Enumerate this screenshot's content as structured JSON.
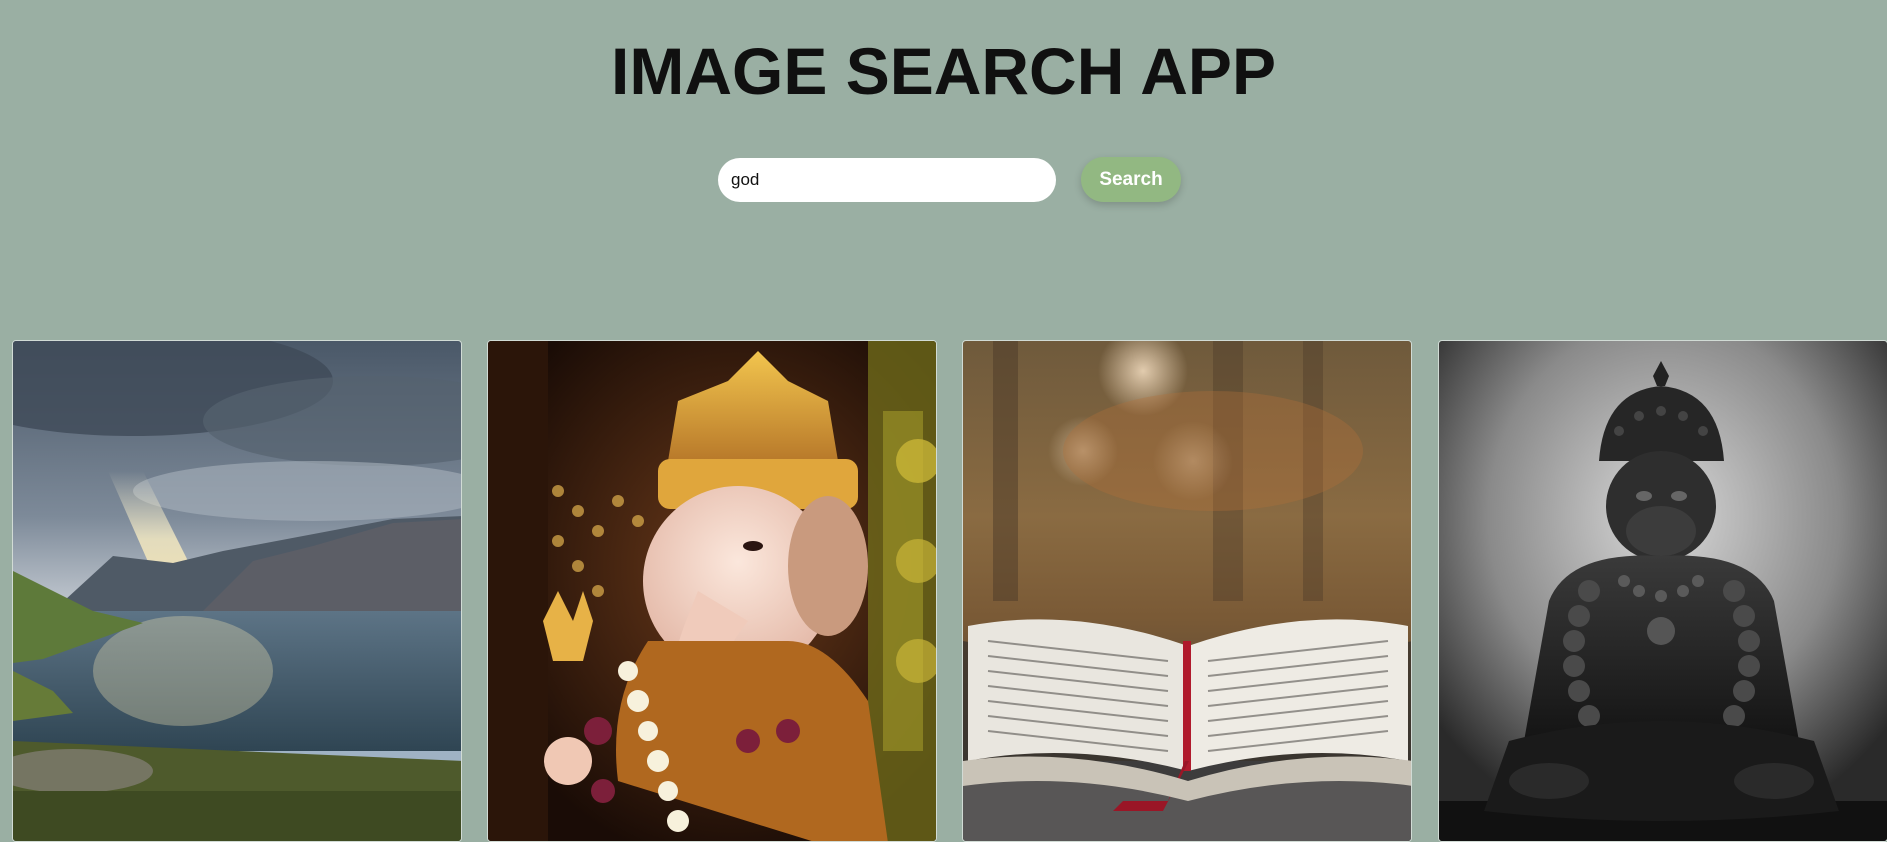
{
  "app": {
    "title": "IMAGE SEARCH APP"
  },
  "search": {
    "value": "god",
    "button_label": "Search"
  },
  "results": [
    {
      "subject": "fjord-with-sunbeam"
    },
    {
      "subject": "ganesha-idol"
    },
    {
      "subject": "open-book"
    },
    {
      "subject": "hanuman-statue"
    }
  ],
  "colors": {
    "background": "#9aafa3",
    "button": "#92b882",
    "title": "#101010"
  }
}
